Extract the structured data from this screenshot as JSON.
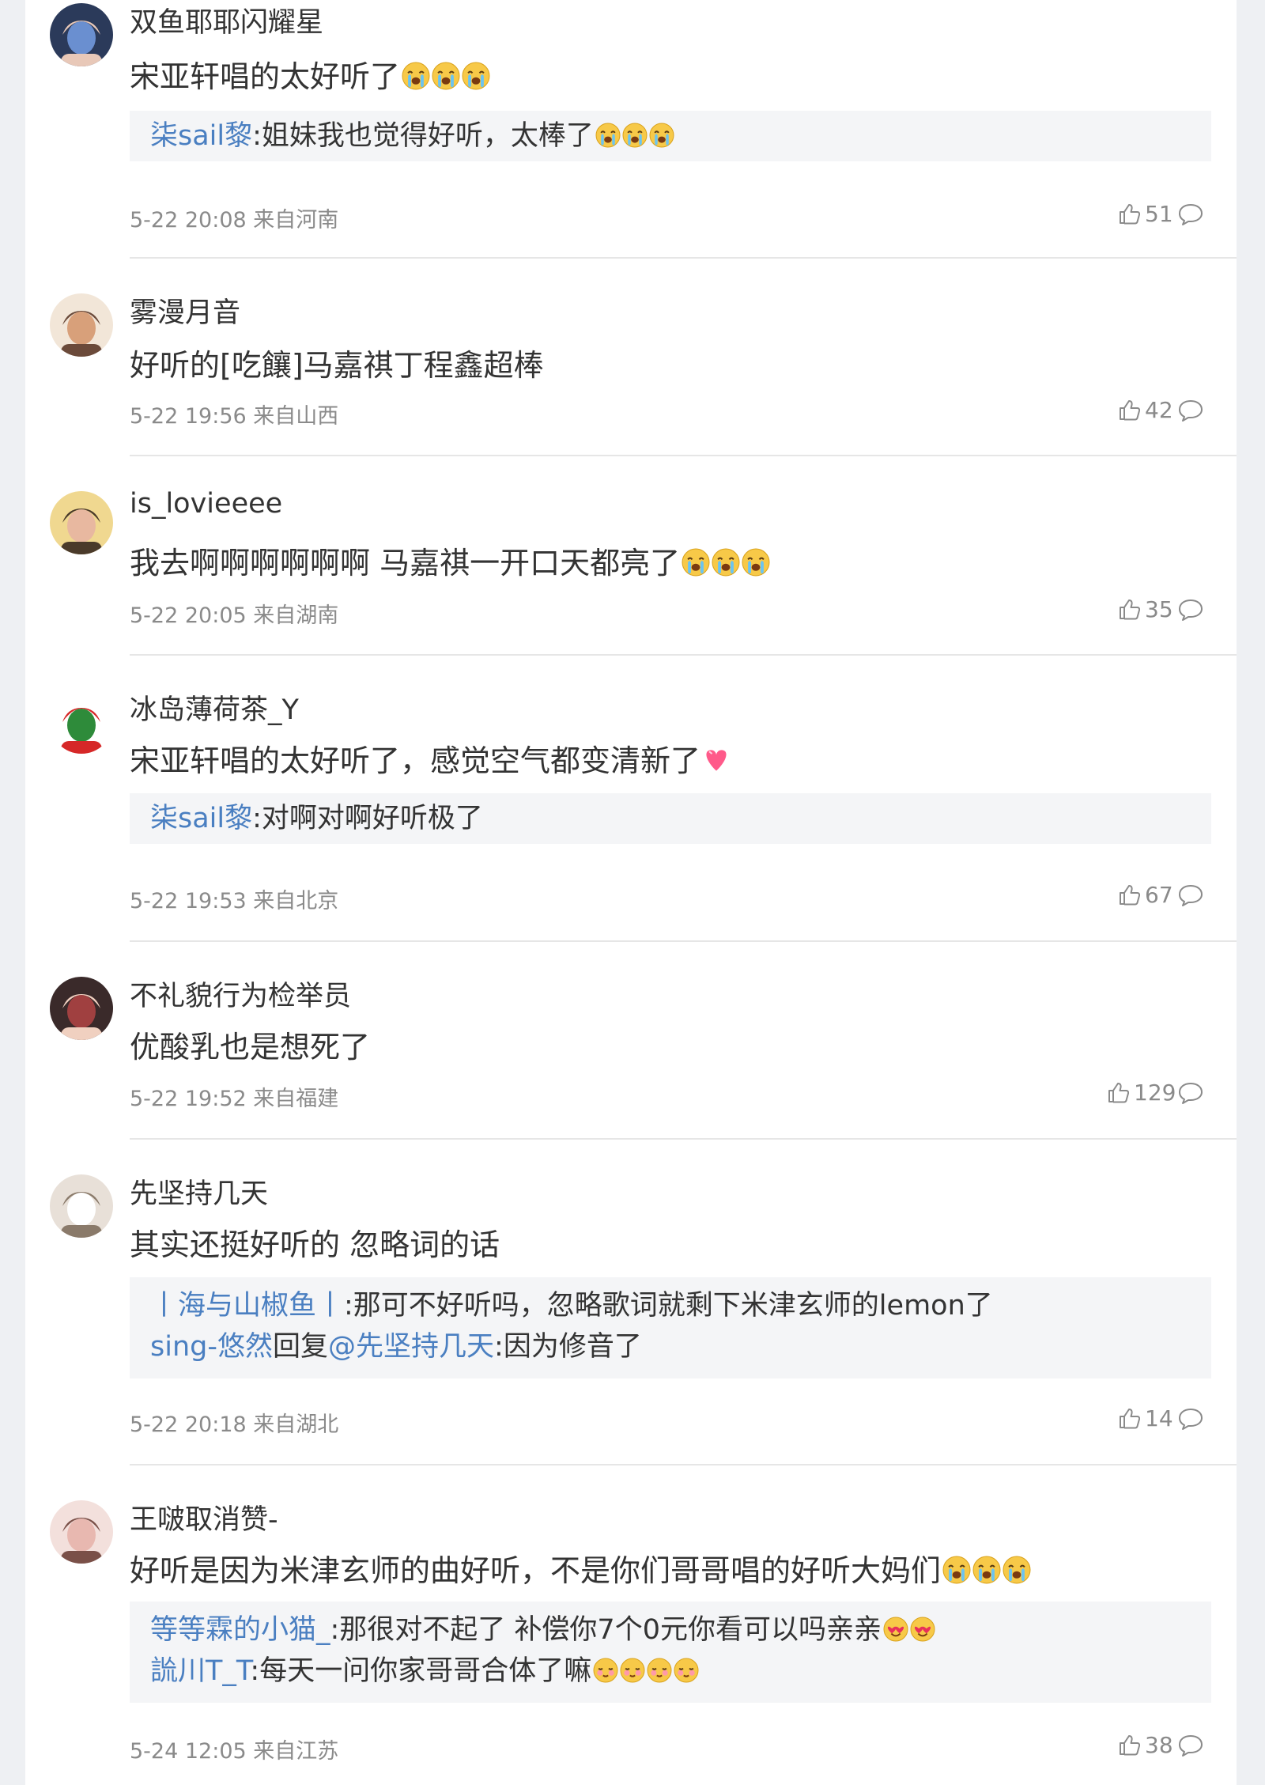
{
  "comments": [
    {
      "username": "双鱼耶耶闪耀星",
      "text": "宋亚轩唱的太好听了",
      "emojis": [
        "cry",
        "cry",
        "cry"
      ],
      "replies": [
        {
          "segments": [
            {
              "t": "柒sail黎",
              "link": true
            },
            {
              "t": ":姐妹我也觉得好听，太棒了"
            }
          ],
          "emojis": [
            "cry",
            "cry",
            "cry"
          ]
        }
      ],
      "time": "5-22 20:08",
      "location": "来自河南",
      "likes": "51"
    },
    {
      "username": "雾漫月音",
      "text": "好听的[吃饟]马嘉祺丁程鑫超棒",
      "emojis": [],
      "replies": [],
      "time": "5-22 19:56",
      "location": "来自山西",
      "likes": "42"
    },
    {
      "username": "is_lovieeee",
      "text": "我去啊啊啊啊啊啊 马嘉祺一开口天都亮了",
      "emojis": [
        "cry",
        "cry",
        "cry"
      ],
      "replies": [],
      "time": "5-22 20:05",
      "location": "来自湖南",
      "likes": "35"
    },
    {
      "username": "冰岛薄荷茶_Y",
      "text": "宋亚轩唱的太好听了，感觉空气都变清新了",
      "emojis": [
        "heart"
      ],
      "replies": [
        {
          "segments": [
            {
              "t": "柒sail黎",
              "link": true
            },
            {
              "t": ":对啊对啊好听极了"
            }
          ],
          "emojis": []
        }
      ],
      "time": "5-22 19:53",
      "location": "来自北京",
      "likes": "67"
    },
    {
      "username": "不礼貌行为检举员",
      "text": "优酸乳也是想死了",
      "emojis": [],
      "replies": [],
      "time": "5-22 19:52",
      "location": "来自福建",
      "likes": "129"
    },
    {
      "username": "先坚持几天",
      "text": "其实还挺好听的 忽略词的话",
      "emojis": [],
      "replies": [
        {
          "segments": [
            {
              "t": "丨海与山椒鱼丨",
              "link": true
            },
            {
              "t": ":那可不好听吗，忽略歌词就剩下米津玄师的lemon了"
            }
          ],
          "emojis": []
        },
        {
          "segments": [
            {
              "t": "sing-悠然",
              "link": true
            },
            {
              "t": "回复"
            },
            {
              "t": "@先坚持几天",
              "link": true
            },
            {
              "t": ":因为修音了"
            }
          ],
          "emojis": []
        }
      ],
      "time": "5-22 20:18",
      "location": "来自湖北",
      "likes": "14"
    },
    {
      "username": "王啵取消赞-",
      "text": "好听是因为米津玄师的曲好听，不是你们哥哥唱的好听大妈们",
      "emojis": [
        "cry",
        "cry",
        "cry"
      ],
      "replies": [
        {
          "segments": [
            {
              "t": "等等霖的小猫_",
              "link": true
            },
            {
              "t": ":那很对不起了 补偿你7个0元你看可以吗亲亲"
            }
          ],
          "emojis": [
            "love",
            "love"
          ]
        },
        {
          "segments": [
            {
              "t": "詤川T_T",
              "link": true
            },
            {
              "t": ":每天一问你家哥哥合体了嘛"
            }
          ],
          "emojis": [
            "shy",
            "shy",
            "shy",
            "shy"
          ]
        }
      ],
      "time": "5-24 12:05",
      "location": "来自江苏",
      "likes": "38"
    }
  ],
  "icons": {
    "like": "thumbs-up-icon",
    "reply": "speech-bubble-icon",
    "cry": "crying-face-emoji",
    "heart": "heart-emoji",
    "love": "heart-eyes-emoji",
    "shy": "shy-face-emoji"
  },
  "colors": {
    "link": "#4a7fc1",
    "meta": "#8a8a8a",
    "reply_bg": "#f4f5f7",
    "divider": "#e6e6e6"
  }
}
